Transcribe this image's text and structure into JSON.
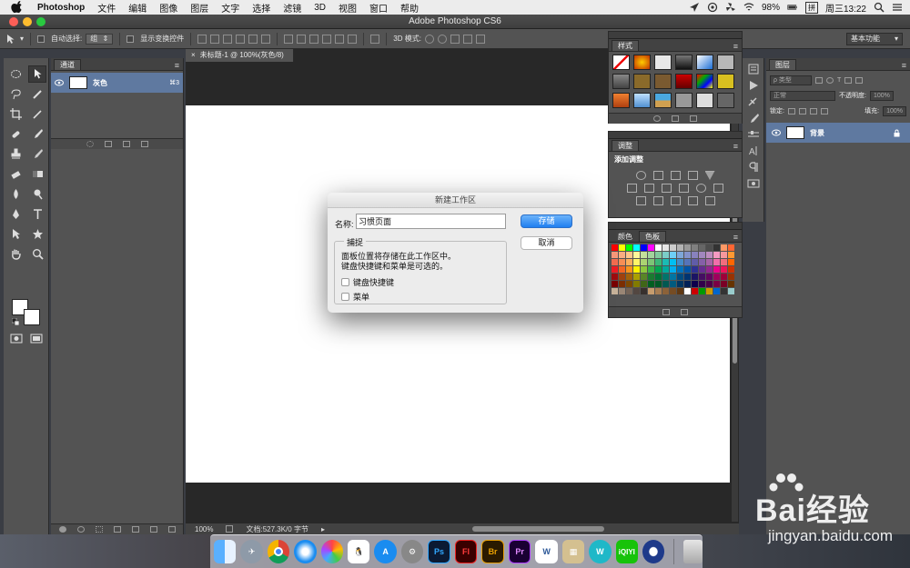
{
  "menubar": {
    "app_name": "Photoshop",
    "items": [
      "文件",
      "编辑",
      "图像",
      "图层",
      "文字",
      "选择",
      "滤镜",
      "3D",
      "视图",
      "窗口",
      "帮助"
    ],
    "battery": "98%",
    "ime": "拼",
    "clock": "周三13:22"
  },
  "window": {
    "title": "Adobe Photoshop CS6"
  },
  "options": {
    "auto_select_label": "自动选择:",
    "auto_select_value": "组",
    "show_transform_label": "显示变换控件",
    "mode_3d_label": "3D 模式:",
    "workspace": "基本功能"
  },
  "channels": {
    "tab": "通道",
    "row": {
      "name": "灰色",
      "shortcut": "⌘3"
    }
  },
  "document": {
    "tab": "未标题-1 @ 100%(灰色/8)",
    "zoom": "100%",
    "docinfo": "文档:527.3K/0 字节"
  },
  "styles_panel": {
    "tab": "样式"
  },
  "adjust_panel": {
    "tab": "调整",
    "title": "添加调整"
  },
  "swatch_panel": {
    "tabs": [
      "颜色",
      "色板"
    ]
  },
  "layers": {
    "tab": "图层",
    "kind": "ρ 类型",
    "blend": "正常",
    "opacity_label": "不透明度:",
    "opacity": "100%",
    "lock_label": "锁定:",
    "fill_label": "填充:",
    "fill": "100%",
    "layer_name": "背景"
  },
  "dialog": {
    "title": "新建工作区",
    "name_label": "名称:",
    "name_value": "习惯页面",
    "save_label": "存储",
    "cancel_label": "取消",
    "capture_title": "捕捉",
    "capture_line1": "面板位置将存储在此工作区中。",
    "capture_line2": "键盘快捷键和菜单是可选的。",
    "cb_shortcuts": "键盘快捷键",
    "cb_menus": "菜单"
  },
  "watermark": {
    "text": "Bai经验",
    "url": "jingyan.baidu.com"
  },
  "dock_apps": [
    "finder",
    "launchpad",
    "chrome",
    "safari",
    "photos",
    "qq",
    "app-store",
    "system-preferences",
    "Ps",
    "Fl",
    "Br",
    "Pr",
    "W",
    "archive",
    "wps",
    "iQIYI",
    "quicktime",
    "trash"
  ]
}
